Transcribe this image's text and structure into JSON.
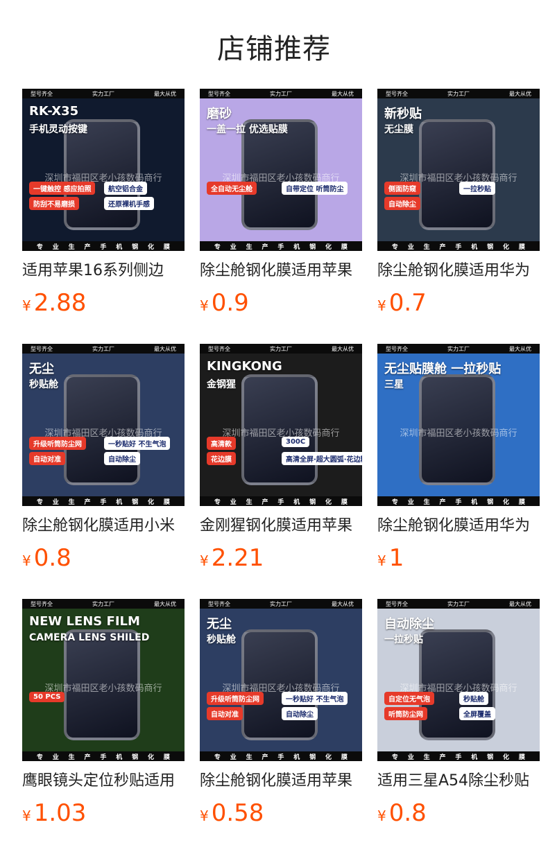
{
  "page": {
    "title": "店铺推荐"
  },
  "products": [
    {
      "name": "适用苹果16系列侧边",
      "currency": "¥",
      "price": "2.88",
      "image": {
        "bg": "#101a2e",
        "top": [
          "型号齐全",
          "实力工厂",
          "最大从优"
        ],
        "bottom": [
          "专",
          "业",
          "生",
          "产",
          "手",
          "机",
          "钢",
          "化",
          "膜"
        ],
        "watermark": "深圳市福田区老小孩数码商行",
        "headline": "RK-X35",
        "sub": "手机灵动按键",
        "chips": [
          "一键触控 感应拍照",
          "航空铝合金",
          "防刮不易磨损",
          "还原裸机手感"
        ]
      }
    },
    {
      "name": "除尘舱钢化膜适用苹果",
      "currency": "¥",
      "price": "0.9",
      "image": {
        "bg": "#b9a7e6",
        "top": [
          "型号齐全",
          "实力工厂",
          "最大从优"
        ],
        "bottom": [
          "专",
          "业",
          "生",
          "产",
          "手",
          "机",
          "钢",
          "化",
          "膜"
        ],
        "watermark": "深圳市福田区老小孩数码商行",
        "headline": "磨砂",
        "sub": "一盖一拉 优选贴膜",
        "chips": [
          "全自动无尘舱",
          "自带定位 听筒防尘"
        ]
      }
    },
    {
      "name": "除尘舱钢化膜适用华为",
      "currency": "¥",
      "price": "0.7",
      "image": {
        "bg": "#2c3a4c",
        "top": [
          "型号齐全",
          "实力工厂",
          "最大从优"
        ],
        "bottom": [
          "专",
          "业",
          "生",
          "产",
          "手",
          "机",
          "钢",
          "化",
          "膜"
        ],
        "watermark": "深圳市福田区老小孩数码商行",
        "headline": "新秒贴",
        "sub": "无尘膜",
        "chips": [
          "侧面防窥",
          "一拉秒贴",
          "自动除尘"
        ]
      }
    },
    {
      "name": "除尘舱钢化膜适用小米",
      "currency": "¥",
      "price": "0.8",
      "image": {
        "bg": "#2d3e62",
        "top": [
          "型号齐全",
          "实力工厂",
          "最大从优"
        ],
        "bottom": [
          "专",
          "业",
          "生",
          "产",
          "手",
          "机",
          "钢",
          "化",
          "膜"
        ],
        "watermark": "深圳市福田区老小孩数码商行",
        "headline": "无尘",
        "sub": "秒贴舱",
        "chips": [
          "升级听筒防尘网",
          "一秒贴好 不生气泡",
          "自动对准",
          "自动除尘"
        ]
      }
    },
    {
      "name": "金刚猩钢化膜适用苹果",
      "currency": "¥",
      "price": "2.21",
      "image": {
        "bg": "#1c1c1c",
        "top": [
          "型号齐全",
          "实力工厂",
          "最大从优"
        ],
        "bottom": [
          "专",
          "业",
          "生",
          "产",
          "手",
          "机",
          "钢",
          "化",
          "膜"
        ],
        "watermark": "深圳市福田区老小孩数码商行",
        "headline": "KINGKONG",
        "sub": "金钢猩",
        "chips": [
          "高清款",
          "300C",
          "花边膜",
          "高清全屏·超大圆弧·花边精雕"
        ]
      }
    },
    {
      "name": "除尘舱钢化膜适用华为",
      "currency": "¥",
      "price": "1",
      "image": {
        "bg": "#2f6fc4",
        "top": [
          "型号齐全",
          "实力工厂",
          "最大从优"
        ],
        "bottom": [
          "专",
          "业",
          "生",
          "产",
          "手",
          "机",
          "钢",
          "化",
          "膜"
        ],
        "watermark": "深圳市福田区老小孩数码商行",
        "headline": "无尘贴膜舱  一拉秒贴",
        "sub": "三星",
        "chips": []
      }
    },
    {
      "name": "鹰眼镜头定位秒贴适用",
      "currency": "¥",
      "price": "1.03",
      "image": {
        "bg": "#1f3d1a",
        "top": [
          "型号齐全",
          "实力工厂",
          "最大从优"
        ],
        "bottom": [
          "专",
          "业",
          "生",
          "产",
          "手",
          "机",
          "钢",
          "化",
          "膜"
        ],
        "watermark": "深圳市福田区老小孩数码商行",
        "headline": "NEW LENS FILM",
        "sub": "CAMERA LENS SHILED",
        "chips": [
          "50 PCS"
        ]
      }
    },
    {
      "name": "除尘舱钢化膜适用苹果",
      "currency": "¥",
      "price": "0.58",
      "image": {
        "bg": "#2d3e62",
        "top": [
          "型号齐全",
          "实力工厂",
          "最大从优"
        ],
        "bottom": [
          "专",
          "业",
          "生",
          "产",
          "手",
          "机",
          "钢",
          "化",
          "膜"
        ],
        "watermark": "深圳市福田区老小孩数码商行",
        "headline": "无尘",
        "sub": "秒贴舱",
        "chips": [
          "升级听筒防尘网",
          "一秒贴好 不生气泡",
          "自动对准",
          "自动除尘"
        ]
      }
    },
    {
      "name": "适用三星A54除尘秒贴",
      "currency": "¥",
      "price": "0.8",
      "image": {
        "bg": "#c9cfdb",
        "top": [
          "型号齐全",
          "实力工厂",
          "最大从优"
        ],
        "bottom": [
          "专",
          "业",
          "生",
          "产",
          "手",
          "机",
          "钢",
          "化",
          "膜"
        ],
        "watermark": "深圳市福田区老小孩数码商行",
        "headline": "自动除尘",
        "sub": "一拉秒贴",
        "chips": [
          "自定位无气泡",
          "秒贴舱",
          "听筒防尘网",
          "全屏覆盖"
        ]
      }
    }
  ]
}
